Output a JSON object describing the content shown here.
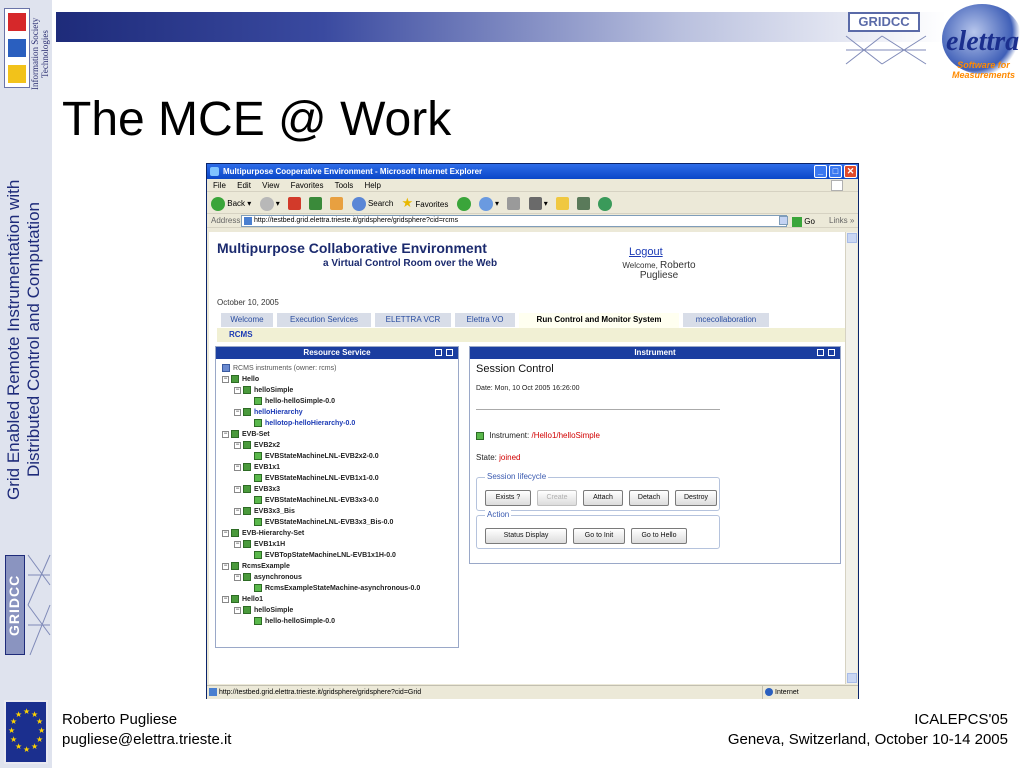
{
  "slide": {
    "title": "The MCE @ Work",
    "vertical_title_line1": "Grid Enabled Remote Instrumentation with",
    "vertical_title_line2": "Distributed Control and Computation",
    "ist_text_line1": "Information Society",
    "ist_text_line2": "Technologies",
    "gridcc_logo": "GRIDCC",
    "elettra_logo": "elettra",
    "elettra_sub_line1": "Software for",
    "elettra_sub_line2": "Measurements",
    "footer_left_name": "Roberto Pugliese",
    "footer_left_email": "pugliese@elettra.trieste.it",
    "footer_right_line1": "ICALEPCS'05",
    "footer_right_line2": "Geneva, Switzerland, October 10-14 2005"
  },
  "browser": {
    "window_title": "Multipurpose Cooperative Environment - Microsoft Internet Explorer",
    "menu": [
      "File",
      "Edit",
      "View",
      "Favorites",
      "Tools",
      "Help"
    ],
    "toolbar": {
      "back": "Back",
      "search": "Search",
      "favorites": "Favorites"
    },
    "address_label": "Address",
    "address_url": "http://testbed.grid.elettra.trieste.it/gridsphere/gridsphere?cid=rcms",
    "go_label": "Go",
    "links_label": "Links",
    "status_url": "http://testbed.grid.elettra.trieste.it/gridsphere/gridsphere?cid=Grid",
    "status_zone": "Internet"
  },
  "page": {
    "app_title": "Multipurpose Collaborative Environment",
    "app_subtitle": "a Virtual Control Room over the Web",
    "logout": "Logout",
    "welcome_label": "Welcome,",
    "welcome_name_line1": "Roberto",
    "welcome_name_line2": "Pugliese",
    "date": "October 10, 2005",
    "tabs": [
      "Welcome",
      "Execution Services",
      "ELETTRA VCR",
      "Elettra VO",
      "Run Control and Monitor System",
      "mcecollaboration"
    ],
    "active_tab_index": 4,
    "sub_tab": "RCMS"
  },
  "resource_service": {
    "title": "Resource Service",
    "root": "RCMS instruments (owner: rcms)",
    "nodes": [
      {
        "label": "Hello",
        "kind": "group"
      },
      {
        "label": "helloSimple",
        "kind": "group"
      },
      {
        "label": "hello-helloSimple-0.0",
        "kind": "leaf"
      },
      {
        "label": "helloHierarchy",
        "kind": "link"
      },
      {
        "label": "hellotop-helloHierarchy-0.0",
        "kind": "leaf-link"
      },
      {
        "label": "EVB-Set",
        "kind": "group"
      },
      {
        "label": "EVB2x2",
        "kind": "group"
      },
      {
        "label": "EVBStateMachineLNL-EVB2x2-0.0",
        "kind": "leaf"
      },
      {
        "label": "EVB1x1",
        "kind": "group"
      },
      {
        "label": "EVBStateMachineLNL-EVB1x1-0.0",
        "kind": "leaf"
      },
      {
        "label": "EVB3x3",
        "kind": "group"
      },
      {
        "label": "EVBStateMachineLNL-EVB3x3-0.0",
        "kind": "leaf"
      },
      {
        "label": "EVB3x3_Bis",
        "kind": "group"
      },
      {
        "label": "EVBStateMachineLNL-EVB3x3_Bis-0.0",
        "kind": "leaf"
      },
      {
        "label": "EVB-Hierarchy-Set",
        "kind": "group"
      },
      {
        "label": "EVB1x1H",
        "kind": "group"
      },
      {
        "label": "EVBTopStateMachineLNL-EVB1x1H-0.0",
        "kind": "leaf"
      },
      {
        "label": "RcmsExample",
        "kind": "group"
      },
      {
        "label": "asynchronous",
        "kind": "group"
      },
      {
        "label": "RcmsExampleStateMachine-asynchronous-0.0",
        "kind": "leaf"
      },
      {
        "label": "Hello1",
        "kind": "group"
      },
      {
        "label": "helloSimple",
        "kind": "group"
      },
      {
        "label": "hello-helloSimple-0.0",
        "kind": "leaf"
      }
    ]
  },
  "instrument": {
    "title": "Instrument",
    "session_title": "Session Control",
    "date_line": "Date: Mon, 10 Oct 2005 16:26:00",
    "instrument_label": "Instrument:",
    "instrument_value": "/Hello1/helloSimple",
    "state_label": "State:",
    "state_value": "joined",
    "lifecycle_legend": "Session lifecycle",
    "lifecycle_buttons": [
      "Exists ?",
      "Create",
      "Attach",
      "Detach",
      "Destroy"
    ],
    "action_legend": "Action",
    "action_buttons": [
      "Status Display",
      "Go to Init",
      "Go to Hello"
    ]
  }
}
